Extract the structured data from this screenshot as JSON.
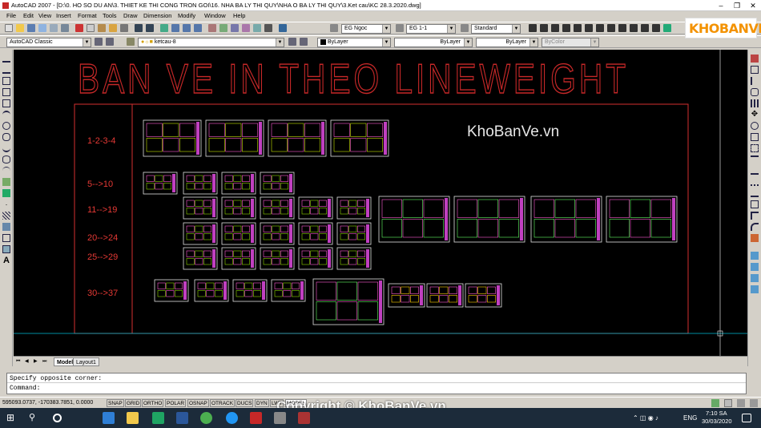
{
  "window": {
    "title": "AutoCAD 2007 - [D:\\0. HO SO DU AN\\3. THIET KE THI CONG TRON GOI\\16. NHA BA LY THI QUY\\NHA O BA LY THI QUY\\3.Ket cau\\KC 28.3.2020.dwg]",
    "minimize": "‒",
    "restore": "❐",
    "close": "✕"
  },
  "menu": [
    "File",
    "Edit",
    "View",
    "Insert",
    "Format",
    "Tools",
    "Draw",
    "Dimension",
    "Modify",
    "Window",
    "Help"
  ],
  "toolbar": {
    "text_style": "EG Ngoc",
    "dim_style": "EG 1-1",
    "table_style": "Standard",
    "workspace": "AutoCAD Classic",
    "layer": "ketcau-8",
    "color": "ByLayer",
    "linetype": "ByLayer",
    "lineweight": "ByLayer",
    "plotstyle": "ByColor"
  },
  "drawing": {
    "title": "BAN VE IN THEO LINEWEIGHT",
    "watermark": "KhoBanVe.vn",
    "row_labels": [
      "1-2-3-4",
      "5-->10",
      "11-->19",
      "20-->24",
      "25-->29",
      "30-->37"
    ]
  },
  "tabs": [
    "Model",
    "Layout1"
  ],
  "tab_nav": [
    "⏮",
    "◀",
    "▶",
    "⏭"
  ],
  "command": {
    "line1": "Specify opposite corner:",
    "line2": "Command:"
  },
  "status": {
    "coords": "595093.0737, -170383.7851, 0.0000",
    "toggles": [
      "SNAP",
      "GRID",
      "ORTHO",
      "POLAR",
      "OSNAP",
      "OTRACK",
      "DUCS",
      "DYN",
      "LWT",
      "MODEL"
    ]
  },
  "taskbar": {
    "time": "7:10 SA",
    "date": "30/03/2020",
    "lang": "ENG"
  },
  "logo": "KHOBANVE",
  "footer_watermark": "Copyright © KhoBanVe.vn",
  "colors": {
    "canvas": "#000000",
    "title_red": "#b71c1c",
    "frame_red": "#d32f2f",
    "label_red": "#e53935"
  }
}
